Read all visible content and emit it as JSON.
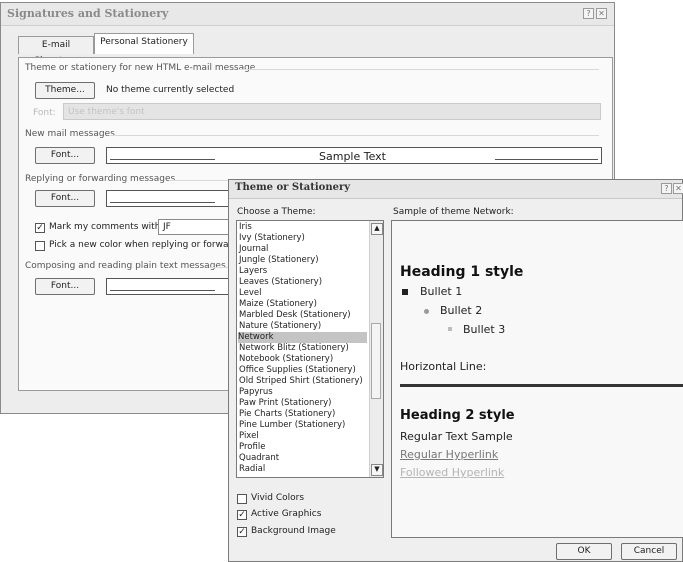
{
  "back_dialog": {
    "title": "Signatures and Stationery",
    "tabs": [
      {
        "label": "E-mail Signature"
      },
      {
        "label": "Personal Stationery"
      }
    ],
    "theme_group": {
      "label": "Theme or stationery for new HTML e-mail message",
      "theme_button": "Theme...",
      "theme_status": "No theme currently selected",
      "font_label": "Font:",
      "font_placeholder": "Use theme's font"
    },
    "new_mail_group": {
      "label": "New mail messages",
      "font_button": "Font...",
      "sample_text": "Sample Text"
    },
    "reply_group": {
      "label": "Replying or forwarding messages",
      "font_button": "Font...",
      "mark_comments_label": "Mark my comments with:",
      "mark_comments_checked": true,
      "mark_comments_value": "JF",
      "pick_color_label": "Pick a new color when replying or forwarding",
      "pick_color_checked": false
    },
    "plain_group": {
      "label": "Composing and reading plain text messages",
      "font_button": "Font..."
    }
  },
  "front_dialog": {
    "title": "Theme or Stationery",
    "choose_label": "Choose a Theme:",
    "sample_label": "Sample of theme Network:",
    "themes": [
      "Iris",
      "Ivy (Stationery)",
      "Journal",
      "Jungle (Stationery)",
      "Layers",
      "Leaves (Stationery)",
      "Level",
      "Maize (Stationery)",
      "Marbled Desk (Stationery)",
      "Nature (Stationery)",
      "Network",
      "Network Blitz (Stationery)",
      "Notebook (Stationery)",
      "Office Supplies (Stationery)",
      "Old Striped Shirt (Stationery)",
      "Papyrus",
      "Paw Print (Stationery)",
      "Pie Charts (Stationery)",
      "Pine Lumber (Stationery)",
      "Pixel",
      "Profile",
      "Quadrant",
      "Radial"
    ],
    "selected_theme": "Network",
    "options": {
      "vivid_colors": {
        "label": "Vivid Colors",
        "checked": false
      },
      "active_graphics": {
        "label": "Active Graphics",
        "checked": true
      },
      "background_image": {
        "label": "Background Image",
        "checked": true
      }
    },
    "preview": {
      "heading1": "Heading 1 style",
      "bullet1": "Bullet 1",
      "bullet2": "Bullet 2",
      "bullet3": "Bullet 3",
      "hline_label": "Horizontal Line:",
      "heading2": "Heading 2 style",
      "regular_text": "Regular Text Sample",
      "regular_link": "Regular Hyperlink",
      "followed_link": "Followed Hyperlink"
    },
    "ok_button": "OK",
    "cancel_button": "Cancel"
  }
}
